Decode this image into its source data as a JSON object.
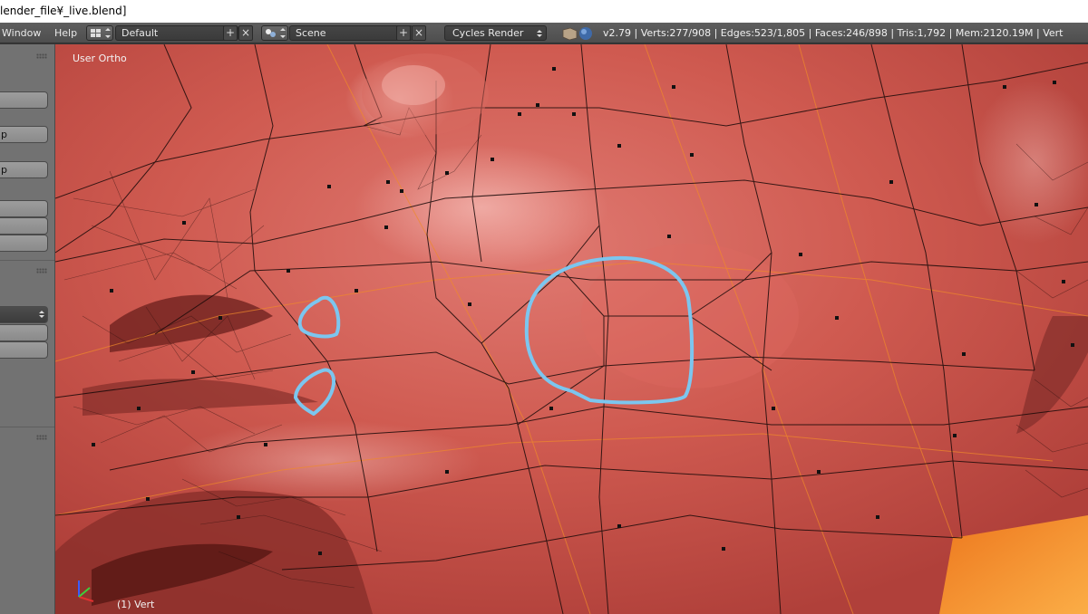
{
  "window": {
    "title": "lender_file¥_live.blend]"
  },
  "menu": {
    "window_label": "Window",
    "help_label": "Help"
  },
  "screen_layout": {
    "value": "Default"
  },
  "scene": {
    "value": "Scene"
  },
  "render_engine": {
    "value": "Cycles Render"
  },
  "stats": {
    "text": "v2.79 | Verts:277/908 | Edges:523/1,805 | Faces:246/898 | Tris:1,792 | Mem:2120.19M | Vert"
  },
  "viewport": {
    "view_label": "User Ortho",
    "object_label": "(1) Vert"
  },
  "colors": {
    "mesh_surface": "#c84f47",
    "highlight_stroke": "#7cc6ef",
    "header_bg": "#565656",
    "toolshelf_bg": "#727272"
  },
  "icons": [
    "screen-layout-icon",
    "scene-icon",
    "add-icon",
    "close-icon",
    "chevron-updown-icon",
    "render-engine-icon",
    "axes-gizmo-icon"
  ]
}
